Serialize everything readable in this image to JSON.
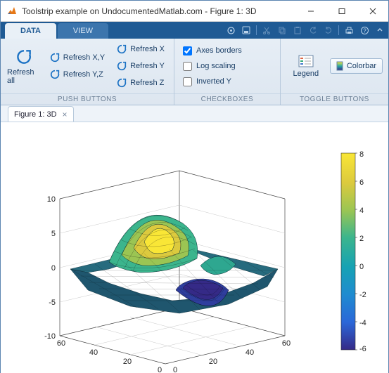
{
  "window": {
    "title": "Toolstrip example on UndocumentedMatlab.com - Figure 1: 3D"
  },
  "tabs": {
    "data": "DATA",
    "view": "VIEW"
  },
  "groups": {
    "push": {
      "label": "PUSH BUTTONS",
      "refresh_all": "Refresh all",
      "refresh_xy": "Refresh X,Y",
      "refresh_yz": "Refresh Y,Z",
      "refresh_x": "Refresh X",
      "refresh_y": "Refresh Y",
      "refresh_z": "Refresh Z"
    },
    "checkboxes": {
      "label": "CHECKBOXES",
      "axes_borders": "Axes borders",
      "log_scaling": "Log scaling",
      "inverted_y": "Inverted Y",
      "axes_borders_checked": true,
      "log_scaling_checked": false,
      "inverted_y_checked": false
    },
    "toggle": {
      "label": "TOGGLE BUTTONS",
      "legend": "Legend",
      "colorbar": "Colorbar"
    }
  },
  "doctab": {
    "label": "Figure 1: 3D"
  },
  "chart_data": {
    "type": "surface",
    "title": "",
    "x_range": [
      0,
      60
    ],
    "y_range": [
      0,
      60
    ],
    "z_range": [
      -10,
      10
    ],
    "x_ticks": [
      0,
      20,
      40,
      60
    ],
    "y_ticks": [
      0,
      20,
      40,
      60
    ],
    "z_ticks": [
      -10,
      -5,
      0,
      5,
      10
    ],
    "colorbar": {
      "min": -6,
      "max": 8,
      "ticks": [
        -6,
        -4,
        -2,
        0,
        2,
        4,
        6,
        8
      ],
      "colormap": "parula"
    },
    "description": "MATLAB peaks-style surface mesh with two gaussian-like lobes, plotted as 3D mesh on square grid",
    "view": "3d-isometric"
  }
}
